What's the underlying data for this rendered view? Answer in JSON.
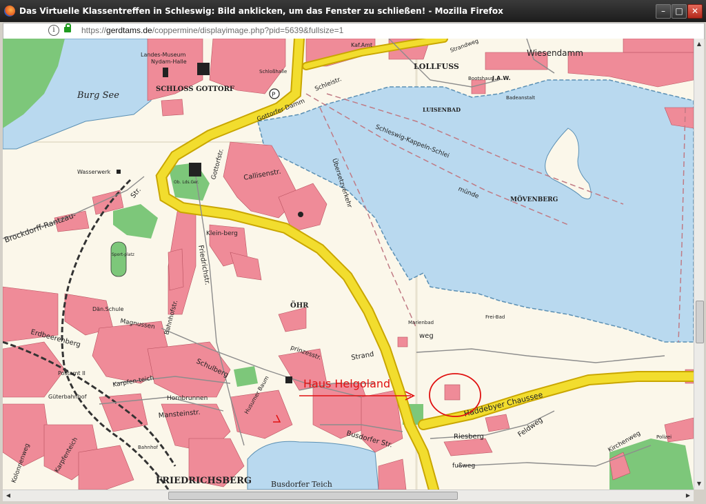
{
  "window": {
    "title": "Das Virtuelle Klassentreffen in Schleswig: Bild anklicken, um das Fenster zu schließen! - Mozilla Firefox",
    "minimize": "–",
    "maximize": "□",
    "close": "✕"
  },
  "urlbar": {
    "scheme": "https://",
    "domain": "gerdtams.de",
    "path": "/coppermine/displayimage.php?pid=5639&fullsize=1"
  },
  "icons": {
    "browser": "firefox-icon",
    "info": "info-icon",
    "lock": "lock-icon"
  },
  "colors": {
    "water": "#b9d9ef",
    "road": "#f2dd2e",
    "building": "#ef8b98",
    "park": "#7dc77a",
    "annotation": "#e01010"
  },
  "map": {
    "labels": {
      "burg_see": "Burg See",
      "landes_museum": "Landes-Museum",
      "nydam_halle": "Nydam-Halle",
      "schloss_gottorf": "SCHLOSS GOTTORF",
      "schlosshalle": "Schloßhalle",
      "kaf_amt": "Kaf.Amt",
      "lollfuss": "LOLLFUSS",
      "strandweg": "Strandweg",
      "wiesendamm": "Wiesendamm",
      "bootshaus": "Bootshaus",
      "jaw": "J.A.W.",
      "badeanstalt": "Badeanstalt",
      "luisenbad": "LUISENBAD",
      "schleswig_kappeln": "Schleswig-Kappeln-Schlei",
      "munde": "münde",
      "movenberg": "MÖVENBERG",
      "wasserwerk": "Wasserwerk",
      "gottorfer_damm": "Gottorfer Damm",
      "schleistr": "Schleistr.",
      "gottorfstr": "Gottorfstr.",
      "callisenstr": "Callisenstr.",
      "brockdorff": "Brockdorff-Rantzau-",
      "str": "Str.",
      "sportplatz": "Sport-platz",
      "ob_lds_ger": "Ob. Lds.Ger.",
      "ubersetzerfahrt": "Übersetzverkehr",
      "kleinberg": "Klein-berg",
      "friedrichstr": "Friedrichstr.",
      "ohr": "ÖHR",
      "dan_schule": "Dän.Schule",
      "magnussen": "Magnussen",
      "erdbeerenberg": "Erdbeerenberg",
      "postamt": "Postamt II",
      "guterbahnhof": "Güterbahnhof",
      "karpfenteich": "Karpfen-teich",
      "bahnhofstr": "Bahnhofstr.",
      "hornbrunnen": "Hornbrunnen",
      "mansteinstr": "Mansteinstr.",
      "schulberg": "Schulberg",
      "husumer_baum": "Husumer Baum",
      "friedrichsberg": "FRIEDRICHSBERG",
      "busdorfer_teich": "Busdorfer Teich",
      "busdorfer_str": "Busdorfer Str.",
      "marienbad": "Marienbad",
      "frei_bad": "Frei-Bad",
      "weg": "weg",
      "strand": "Strand",
      "prinzesstr": "prinzesstr.",
      "haddebyer_chaussee": "Haddebyer Chaussee",
      "riesberg": "Riesberg",
      "feldweg": "Feldweg",
      "fussweg": "fußweg",
      "kirchenweg": "Kirchenweg",
      "polizei": "Polizei",
      "bahnhof": "Bahnhof",
      "kolonnenweg": "Kolonnenweg",
      "karpfenteich_str": "Karpfenteich"
    },
    "annotation": "Haus Helgoland"
  }
}
